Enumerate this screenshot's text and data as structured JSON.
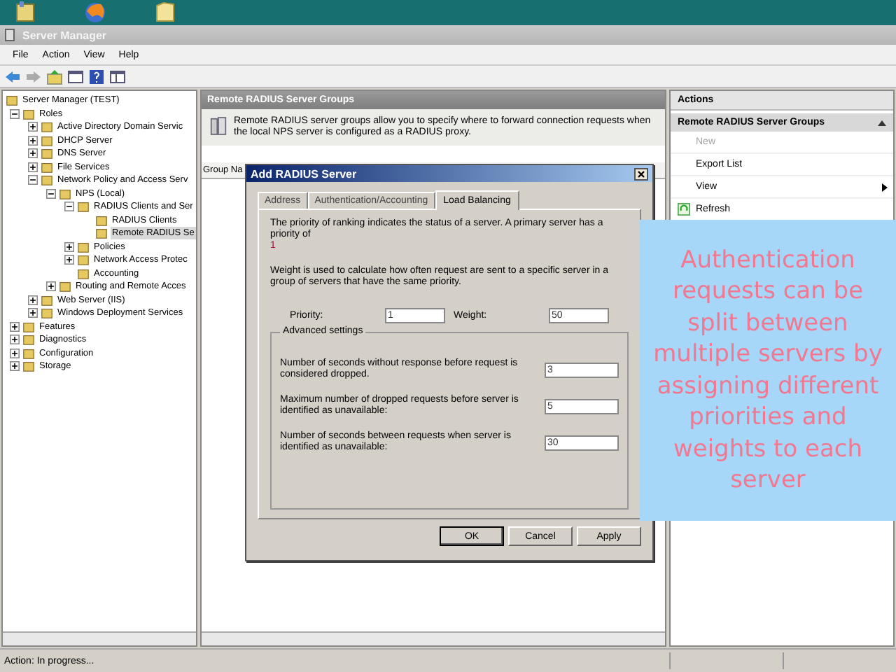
{
  "window": {
    "title": "Server Manager"
  },
  "menu": [
    "File",
    "Action",
    "View",
    "Help"
  ],
  "tree": [
    {
      "label": "Server Manager (TEST)",
      "kind": "root",
      "selected": false,
      "children": [
        {
          "label": "Roles",
          "kind": "branch",
          "expanded": true,
          "selected": false,
          "children": [
            {
              "label": "Active Directory Domain Servic",
              "kind": "branch",
              "expanded": false,
              "selected": false
            },
            {
              "label": "DHCP Server",
              "kind": "branch",
              "expanded": false,
              "selected": false
            },
            {
              "label": "DNS Server",
              "kind": "branch",
              "expanded": false,
              "selected": false
            },
            {
              "label": "File Services",
              "kind": "branch",
              "expanded": false,
              "selected": false
            },
            {
              "label": "Network Policy and Access Serv",
              "kind": "branch",
              "expanded": true,
              "selected": false,
              "children": [
                {
                  "label": "NPS (Local)",
                  "kind": "branch",
                  "expanded": true,
                  "selected": false,
                  "children": [
                    {
                      "label": "RADIUS Clients and Ser",
                      "kind": "branch",
                      "expanded": true,
                      "selected": false,
                      "children": [
                        {
                          "label": "RADIUS Clients",
                          "kind": "leaf",
                          "selected": false
                        },
                        {
                          "label": "Remote RADIUS Se",
                          "kind": "leaf",
                          "selected": true
                        }
                      ]
                    },
                    {
                      "label": "Policies",
                      "kind": "branch",
                      "expanded": false,
                      "selected": false
                    },
                    {
                      "label": "Network Access Protec",
                      "kind": "branch",
                      "expanded": false,
                      "selected": false
                    },
                    {
                      "label": "Accounting",
                      "kind": "leaf",
                      "selected": false
                    }
                  ]
                },
                {
                  "label": "Routing and Remote Acces",
                  "kind": "branch",
                  "expanded": false,
                  "selected": false
                }
              ]
            },
            {
              "label": "Web Server (IIS)",
              "kind": "branch",
              "expanded": false,
              "selected": false
            },
            {
              "label": "Windows Deployment Services",
              "kind": "branch",
              "expanded": false,
              "selected": false
            }
          ]
        },
        {
          "label": "Features",
          "kind": "branch",
          "expanded": false,
          "selected": false
        },
        {
          "label": "Diagnostics",
          "kind": "branch",
          "expanded": false,
          "selected": false
        },
        {
          "label": "Configuration",
          "kind": "branch",
          "expanded": false,
          "selected": false
        },
        {
          "label": "Storage",
          "kind": "branch",
          "expanded": false,
          "selected": false
        }
      ]
    }
  ],
  "content": {
    "header": "Remote RADIUS Server Groups",
    "description": "Remote RADIUS server groups allow you to specify where to forward connection requests when the local NPS server is configured as a RADIUS proxy.",
    "columns": [
      "Group Na"
    ]
  },
  "actions": {
    "title": "Actions",
    "section": "Remote RADIUS Server Groups",
    "items": [
      {
        "label": "New",
        "kind": "plain",
        "disabled": true
      },
      {
        "label": "Export List",
        "kind": "plain",
        "disabled": false
      },
      {
        "label": "View",
        "kind": "submenu",
        "disabled": false
      },
      {
        "label": "Refresh",
        "kind": "refresh",
        "disabled": false
      }
    ]
  },
  "dialog": {
    "title": "Add RADIUS Server",
    "tabs": [
      {
        "label": "Address",
        "selected": false
      },
      {
        "label": "Authentication/Accounting",
        "selected": false
      },
      {
        "label": "Load Balancing",
        "selected": true
      }
    ],
    "intro": "The priority of ranking indicates the status of a server. A primary server has a priority of",
    "intro_value": "1",
    "weight_note": "Weight is used to calculate how often request are sent to a specific server in a group of servers that have the same priority.",
    "priority": {
      "label": "Priority:",
      "value": "1"
    },
    "weight": {
      "label": "Weight:",
      "value": "50"
    },
    "group_title": "Advanced settings",
    "settings": [
      {
        "label": "Number of seconds without response before request is considered dropped.",
        "value": "3"
      },
      {
        "label": "Maximum number of dropped requests before server is identified as unavailable:",
        "value": "5"
      },
      {
        "label": "Number of seconds between requests when server is identified as unavailable:",
        "value": "30"
      }
    ],
    "buttons": [
      {
        "label": "OK",
        "default": true
      },
      {
        "label": "Cancel",
        "default": false
      },
      {
        "label": "Apply",
        "default": false
      }
    ]
  },
  "callout": "Authentication requests can be split between multiple servers by assigning different priorities and weights to each server",
  "status_bar": "Action:  In progress..."
}
